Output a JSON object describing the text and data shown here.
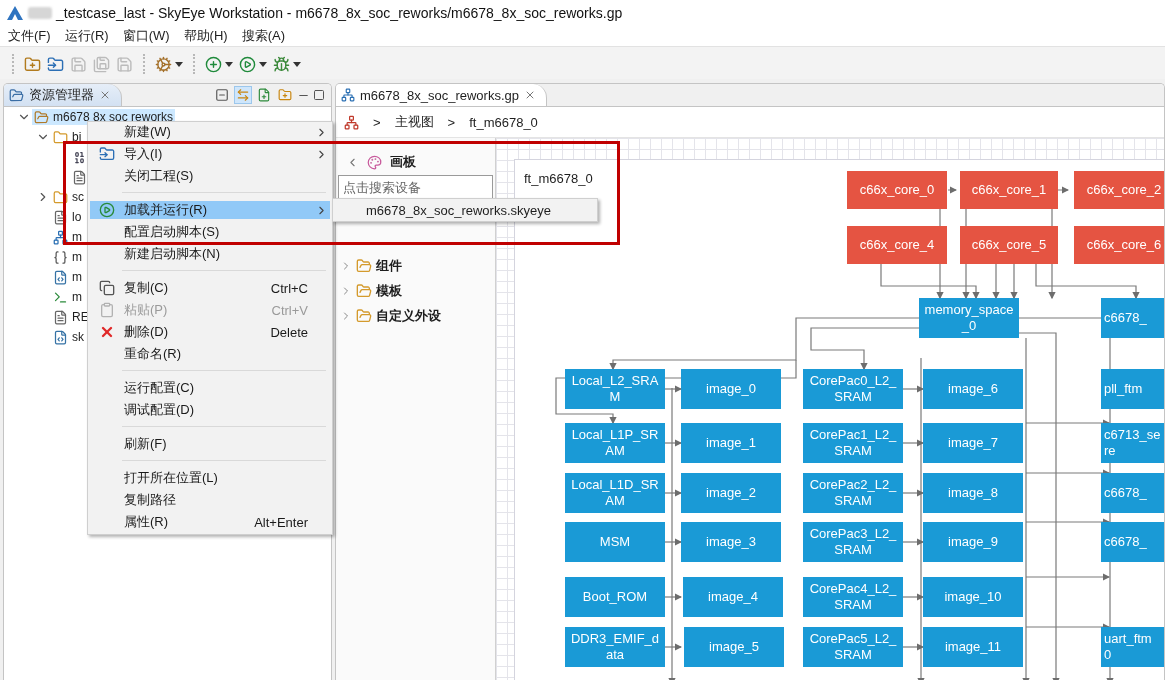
{
  "window": {
    "title": "_testcase_last - SkyEye Workstation - m6678_8x_soc_reworks/m6678_8x_soc_reworks.gp"
  },
  "menu_bar": [
    "文件(F)",
    "运行(R)",
    "窗口(W)",
    "帮助(H)",
    "搜索(A)"
  ],
  "toolbar": {
    "buttons": [
      {
        "disabled": false
      },
      {
        "disabled": false
      },
      {
        "disabled": true
      },
      {
        "disabled": true
      },
      {
        "disabled": true
      },
      {
        "disabled": false
      },
      {
        "disabled": false
      },
      {
        "disabled": false
      },
      {
        "disabled": false
      }
    ]
  },
  "explorer": {
    "tab": "资源管理器",
    "tree": [
      {
        "label": "m6678 8x soc reworks",
        "kind": "project",
        "expanded": true,
        "selected": true,
        "children": [
          {
            "label": "bi",
            "kind": "folder",
            "expanded": true,
            "selected": false,
            "children": [
              {
                "kind": "binary",
                "selected": false
              },
              {
                "kind": "file",
                "selected": false
              }
            ]
          },
          {
            "label": "sc",
            "kind": "folder",
            "expanded": false,
            "selected": false
          },
          {
            "label": "lo",
            "kind": "file",
            "selected": false
          },
          {
            "label": "m",
            "kind": "diagram",
            "selected": false
          },
          {
            "label": "m",
            "kind": "json",
            "selected": false
          },
          {
            "label": "m",
            "kind": "python",
            "selected": false
          },
          {
            "label": "m",
            "kind": "script",
            "selected": false
          },
          {
            "label": "RE",
            "kind": "file",
            "selected": false
          },
          {
            "label": "sk",
            "kind": "python",
            "selected": false
          }
        ]
      }
    ]
  },
  "context_menu": [
    {
      "kind": "item",
      "label": "新建(W)",
      "submenu": true,
      "selected": false,
      "disabled": false
    },
    {
      "kind": "item",
      "label": "导入(I)",
      "submenu": true,
      "selected": false,
      "disabled": false
    },
    {
      "kind": "item",
      "label": "关闭工程(S)",
      "submenu": false,
      "selected": false,
      "disabled": false
    },
    {
      "kind": "separator"
    },
    {
      "kind": "item",
      "label": "加载并运行(R)",
      "submenu": true,
      "selected": true,
      "disabled": false
    },
    {
      "kind": "item",
      "label": "配置启动脚本(S)",
      "submenu": false,
      "selected": false,
      "disabled": false
    },
    {
      "kind": "item",
      "label": "新建启动脚本(N)",
      "submenu": false,
      "selected": false,
      "disabled": false
    },
    {
      "kind": "separator"
    },
    {
      "kind": "item",
      "label": "复制(C)",
      "shortcut": "Ctrl+C",
      "submenu": false,
      "selected": false,
      "disabled": false
    },
    {
      "kind": "item",
      "label": "粘贴(P)",
      "shortcut": "Ctrl+V",
      "submenu": false,
      "selected": false,
      "disabled": true
    },
    {
      "kind": "item",
      "label": "删除(D)",
      "shortcut": "Delete",
      "submenu": false,
      "selected": false,
      "disabled": false
    },
    {
      "kind": "item",
      "label": "重命名(R)",
      "submenu": false,
      "selected": false,
      "disabled": false
    },
    {
      "kind": "separator"
    },
    {
      "kind": "item",
      "label": "运行配置(C)",
      "submenu": false,
      "selected": false,
      "disabled": false
    },
    {
      "kind": "item",
      "label": "调试配置(D)",
      "submenu": false,
      "selected": false,
      "disabled": false
    },
    {
      "kind": "separator"
    },
    {
      "kind": "item",
      "label": "刷新(F)",
      "submenu": false,
      "selected": false,
      "disabled": false
    },
    {
      "kind": "separator"
    },
    {
      "kind": "item",
      "label": "打开所在位置(L)",
      "submenu": false,
      "selected": false,
      "disabled": false
    },
    {
      "kind": "item",
      "label": "复制路径",
      "submenu": false,
      "selected": false,
      "disabled": false
    },
    {
      "kind": "item",
      "label": "属性(R)",
      "shortcut": "Alt+Enter",
      "submenu": false,
      "selected": false,
      "disabled": false
    }
  ],
  "submenu": [
    "m6678_8x_soc_reworks.skyeye"
  ],
  "editor": {
    "tab": "m6678_8x_soc_reworks.gp",
    "breadcrumb": {
      "separator": ">",
      "items": [
        "主视图",
        "ft_m6678_0"
      ]
    },
    "palette": {
      "title": "画板",
      "search_placeholder": "点击搜索设备",
      "groups": [
        {
          "label": "组件",
          "expanded": false
        },
        {
          "label": "模板",
          "expanded": false
        },
        {
          "label": "自定义外设",
          "expanded": false
        }
      ]
    },
    "diagram": {
      "title": "ft_m6678_0",
      "nodes": [
        {
          "label": "c66x_core_0",
          "kind": "core"
        },
        {
          "label": "c66x_core_1",
          "kind": "core"
        },
        {
          "label": "c66x_core_2",
          "kind": "core"
        },
        {
          "label": "c66x_core_4",
          "kind": "core"
        },
        {
          "label": "c66x_core_5",
          "kind": "core"
        },
        {
          "label": "c66x_core_6",
          "kind": "core"
        },
        {
          "label": "memory_space_0",
          "kind": "device"
        },
        {
          "label": "c6678_",
          "kind": "device"
        },
        {
          "label": "Local_L2_SRAM",
          "kind": "device"
        },
        {
          "label": "image_0",
          "kind": "device"
        },
        {
          "label": "CorePac0_L2_SRAM",
          "kind": "device"
        },
        {
          "label": "image_6",
          "kind": "device"
        },
        {
          "label": "pll_ftm",
          "kind": "device"
        },
        {
          "label": "Local_L1P_SRAM",
          "kind": "device"
        },
        {
          "label": "image_1",
          "kind": "device"
        },
        {
          "label": "CorePac1_L2_SRAM",
          "kind": "device"
        },
        {
          "label": "image_7",
          "kind": "device"
        },
        {
          "label": "c6713_se\nre",
          "kind": "device"
        },
        {
          "label": "Local_L1D_SRAM",
          "kind": "device"
        },
        {
          "label": "image_2",
          "kind": "device"
        },
        {
          "label": "CorePac2_L2_SRAM",
          "kind": "device"
        },
        {
          "label": "image_8",
          "kind": "device"
        },
        {
          "label": "c6678_",
          "kind": "device"
        },
        {
          "label": "MSM",
          "kind": "device"
        },
        {
          "label": "image_3",
          "kind": "device"
        },
        {
          "label": "CorePac3_L2_SRAM",
          "kind": "device"
        },
        {
          "label": "image_9",
          "kind": "device"
        },
        {
          "label": "c6678_",
          "kind": "device"
        },
        {
          "label": "Boot_ROM",
          "kind": "device"
        },
        {
          "label": "image_4",
          "kind": "device"
        },
        {
          "label": "CorePac4_L2_SRAM",
          "kind": "device"
        },
        {
          "label": "image_10",
          "kind": "device"
        },
        {
          "label": "DDR3_EMIF_data",
          "kind": "device"
        },
        {
          "label": "image_5",
          "kind": "device"
        },
        {
          "label": "CorePac5_L2_SRAM",
          "kind": "device"
        },
        {
          "label": "image_11",
          "kind": "device"
        },
        {
          "label": "uart_ftm\n0",
          "kind": "device"
        }
      ]
    }
  }
}
